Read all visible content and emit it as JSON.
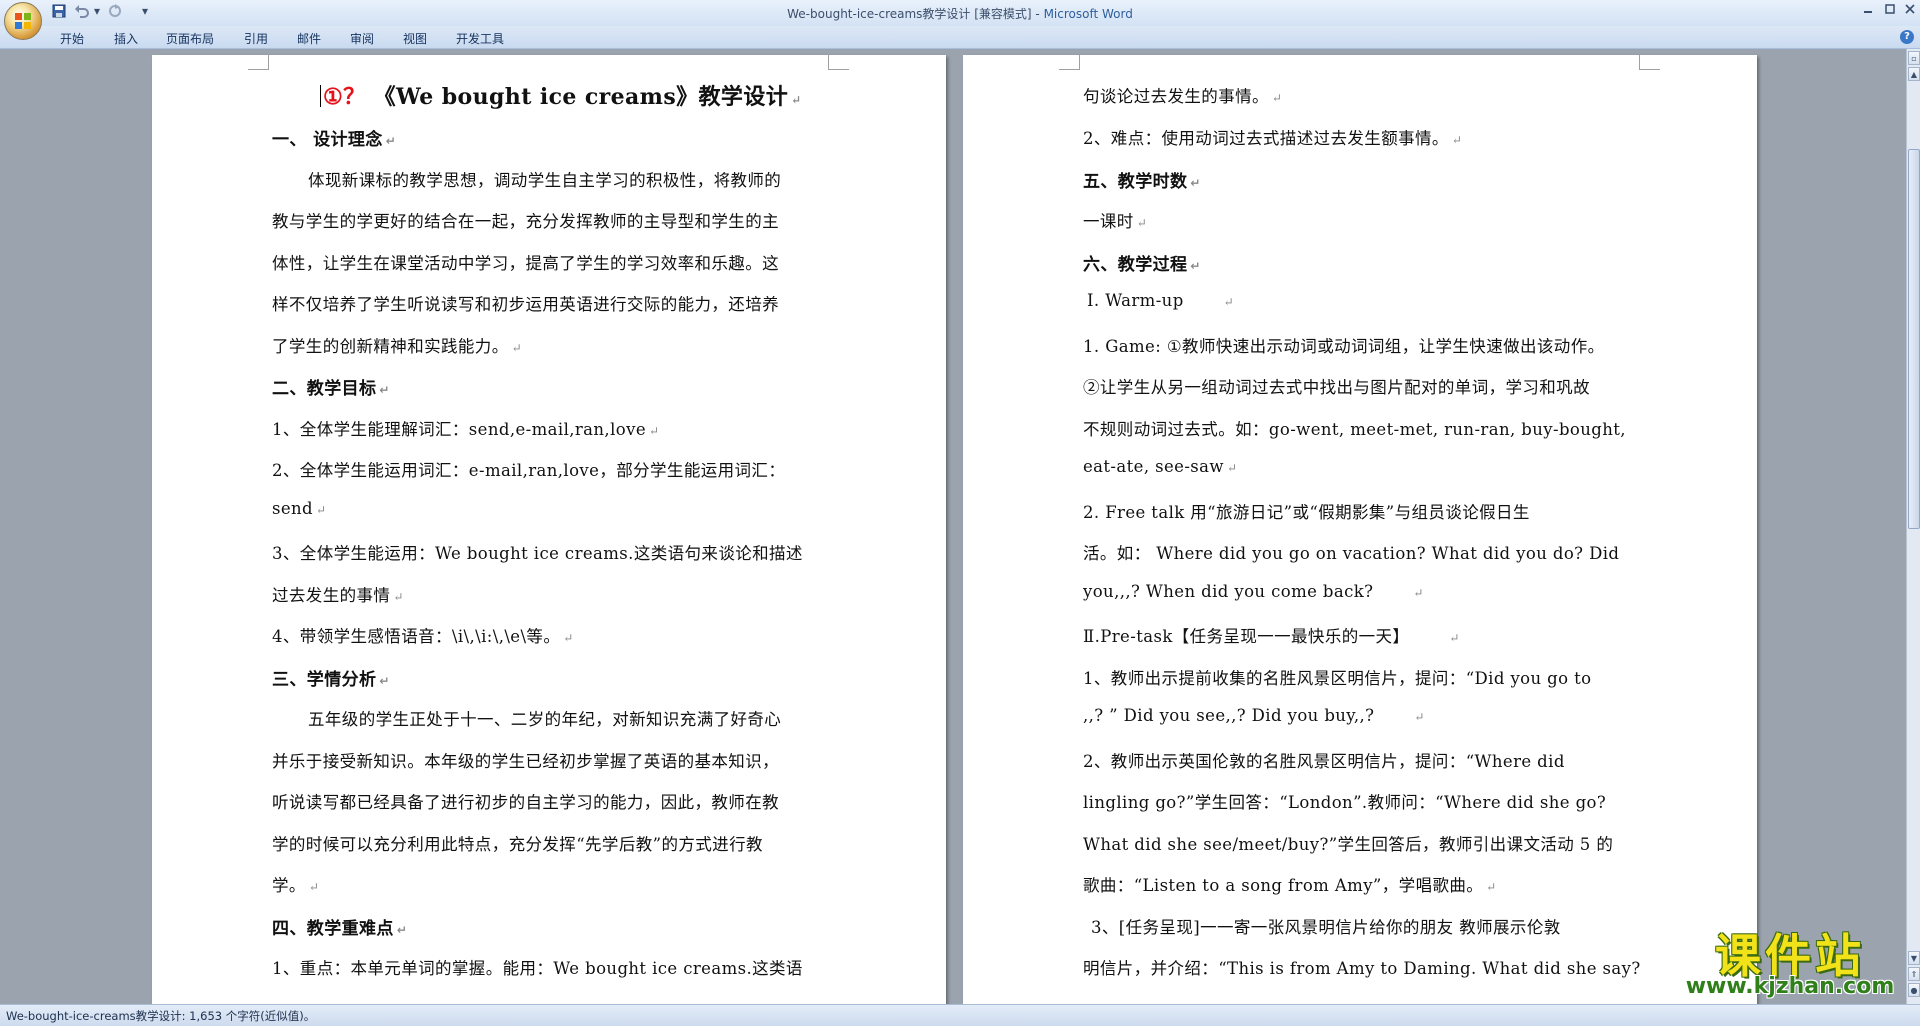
{
  "window": {
    "title_doc": "We-bought-ice-creams教学设计 [兼容模式]",
    "title_sep": " - ",
    "title_app": "Microsoft Word"
  },
  "qat": {
    "dropdown_glyph": "▾"
  },
  "ribbon": {
    "tabs": [
      "开始",
      "插入",
      "页面布局",
      "引用",
      "邮件",
      "审阅",
      "视图",
      "开发工具"
    ]
  },
  "page1": {
    "title_marks": "①？",
    "title_text": "《We bought ice creams》教学设计",
    "lines": [
      "一、 设计理念",
      "体现新课标的教学思想，调动学生自主学习的积极性，将教师的",
      "教与学生的学更好的结合在一起，充分发挥教师的主导型和学生的主",
      "体性，让学生在课堂活动中学习，提高了学生的学习效率和乐趣。这",
      "样不仅培养了学生听说读写和初步运用英语进行交际的能力，还培养",
      "了学生的创新精神和实践能力。",
      "二、教学目标",
      "1、全体学生能理解词汇：send,e-mail,ran,love",
      "2、全体学生能运用词汇：e-mail,ran,love，部分学生能运用词汇：",
      "send",
      "3、全体学生能运用：We bought ice creams.这类语句来谈论和描述",
      "过去发生的事情",
      "4、带领学生感悟语音：\\i\\,\\i:\\,\\e\\等。",
      "三、学情分析",
      "五年级的学生正处于十一、二岁的年纪，对新知识充满了好奇心",
      "并乐于接受新知识。本年级的学生已经初步掌握了英语的基本知识，",
      "听说读写都已经具备了进行初步的自主学习的能力，因此，教师在教",
      "学的时候可以充分利用此特点，充分发挥“先学后教”的方式进行教",
      "学。",
      "四、教学重难点",
      "1、重点：本单元单词的掌握。能用：We bought ice creams.这类语"
    ]
  },
  "page2": {
    "lines": [
      "句谈论过去发生的事情。",
      "2、难点：使用动词过去式描述过去发生额事情。",
      "五、教学时数",
      "一课时",
      "六、教学过程",
      "Ⅰ. Warm-up",
      "1. Game: ①教师快速出示动词或动词词组，让学生快速做出该动作。",
      "②让学生从另一组动词过去式中找出与图片配对的单词，学习和巩故",
      "不规则动词过去式。如：go-went, meet-met, run-ran, buy-bought,",
      "eat-ate, see-saw",
      "2. Free talk   用“旅游日记”或“假期影集”与组员谈论假日生",
      "活。如： Where did you go on vacation?   What did you do?   Did",
      "you,,,?   When did you come back?",
      "Ⅱ.Pre-task【任务呈现一一最快乐的一天】",
      "1、教师出示提前收集的名胜风景区明信片，提问：“Did you go to",
      ",,? ” Did you see,,? Did you buy,,?",
      "2、教师出示英国伦敦的名胜风景区明信片，提问：“Where did",
      "lingling go?”学生回答：“London”.教师问：“Where did she go?",
      "What did she see/meet/buy?”学生回答后，教师引出课文活动 5 的",
      "歌曲：“Listen to a song from Amy”，学唱歌曲。",
      "3、[任务呈现]一一寄一张风景明信片给你的朋友   教师展示伦敦",
      "明信片，并介绍：“This is from Amy to Daming. What did she say?"
    ]
  },
  "statusbar": {
    "text": "We-bought-ice-creams教学设计: 1,653 个字符(近似值)。"
  },
  "watermark": {
    "title": "课件站",
    "url": "www.kjzhan.com"
  },
  "colors": {
    "title_red": "#e4121a",
    "app_blue": "#2e5f9c",
    "watermark_yellow": "#f2e21a",
    "watermark_green": "#2f7f1a"
  }
}
